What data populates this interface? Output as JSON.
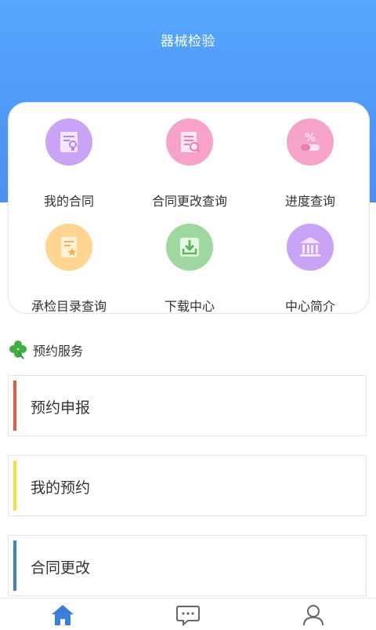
{
  "header": {
    "title": "器械检验",
    "color": "#4a90f0"
  },
  "grid": {
    "items": [
      {
        "label": "我的合同",
        "icon": "contract-icon",
        "color": "#c9a3f5"
      },
      {
        "label": "合同更改查询",
        "icon": "contract-search-icon",
        "color": "#f7a3c9"
      },
      {
        "label": "进度查询",
        "icon": "progress-percent-icon",
        "color": "#f7a3c9"
      },
      {
        "label": "承检目录查询",
        "icon": "catalog-star-icon",
        "color": "#ffd58f"
      },
      {
        "label": "下载中心",
        "icon": "download-tray-icon",
        "color": "#9ed89e"
      },
      {
        "label": "中心简介",
        "icon": "building-columns-icon",
        "color": "#c9a3f5"
      }
    ]
  },
  "section": {
    "title": "预约服务",
    "icon": "clover-icon",
    "icon_color": "#3cb043"
  },
  "services": [
    {
      "label": "预约申报",
      "accent": "#f0563c"
    },
    {
      "label": "我的预约",
      "accent": "#f5e03a"
    },
    {
      "label": "合同更改",
      "accent": "#3b7fd8"
    }
  ],
  "tabbar": {
    "tabs": [
      {
        "icon": "home-icon",
        "active": true,
        "color": "#3b7fd8"
      },
      {
        "icon": "message-icon",
        "active": false,
        "color": "#666666"
      },
      {
        "icon": "user-icon",
        "active": false,
        "color": "#666666"
      }
    ]
  }
}
